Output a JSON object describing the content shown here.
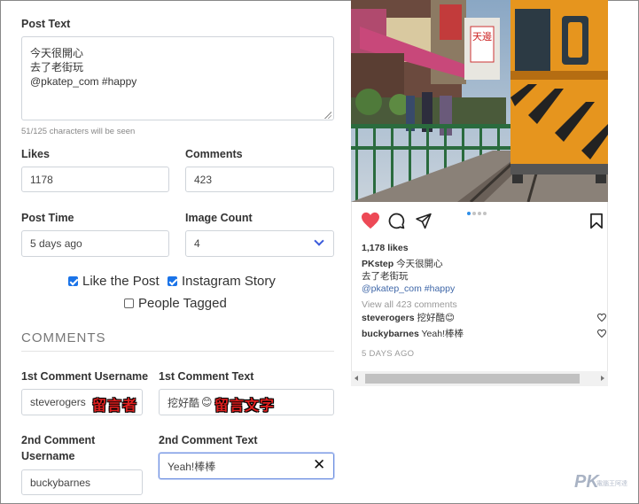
{
  "form": {
    "post_text_label": "Post Text",
    "post_text_value": "今天很開心\n去了老街玩\n@pkatep_com #happy",
    "char_hint": "51/125 characters will be seen",
    "likes_label": "Likes",
    "likes_value": "1178",
    "comments_label": "Comments",
    "comments_value": "423",
    "post_time_label": "Post Time",
    "post_time_value": "5 days ago",
    "image_count_label": "Image Count",
    "image_count_value": "4",
    "options": [
      {
        "label": "Like the Post",
        "checked": true
      },
      {
        "label": "Instagram Story",
        "checked": true
      },
      {
        "label": "People Tagged",
        "checked": false
      }
    ],
    "comments_section_title": "COMMENTS",
    "c1_user_label": "1st Comment Username",
    "c1_user_value": "steverogers",
    "c1_text_label": "1st Comment Text",
    "c1_text_value": "挖好酷",
    "c2_user_label_line1": "2nd Comment",
    "c2_user_label_line2": "Username",
    "c2_user_value": "buckybarnes",
    "c2_text_label": "2nd Comment Text",
    "c2_text_value": "Yeah!棒棒",
    "annotation_user": "留言者",
    "annotation_text": "留言文字"
  },
  "preview": {
    "likes": "1,178 likes",
    "username": "PKstep",
    "caption_line1": "今天很開心",
    "caption_line2": "去了老街玩",
    "tags": "@pkatep_com #happy",
    "view_all": "View all 423 comments",
    "comment1_user": "steverogers",
    "comment1_text": "挖好酷",
    "comment2_user": "buckybarnes",
    "comment2_text": "Yeah!棒棒",
    "time": "5 DAYS AGO",
    "sign_text": "天邊"
  },
  "watermark": {
    "main": "PK",
    "sub": "電腦王阿達"
  },
  "colors": {
    "heart": "#ed4956",
    "accent": "#1a73e8",
    "select_chevron": "#3b5bdb"
  },
  "icons": [
    "heart-icon",
    "comment-icon",
    "share-icon",
    "bookmark-icon",
    "small-heart-icon",
    "clear-icon",
    "chevron-down-icon"
  ]
}
